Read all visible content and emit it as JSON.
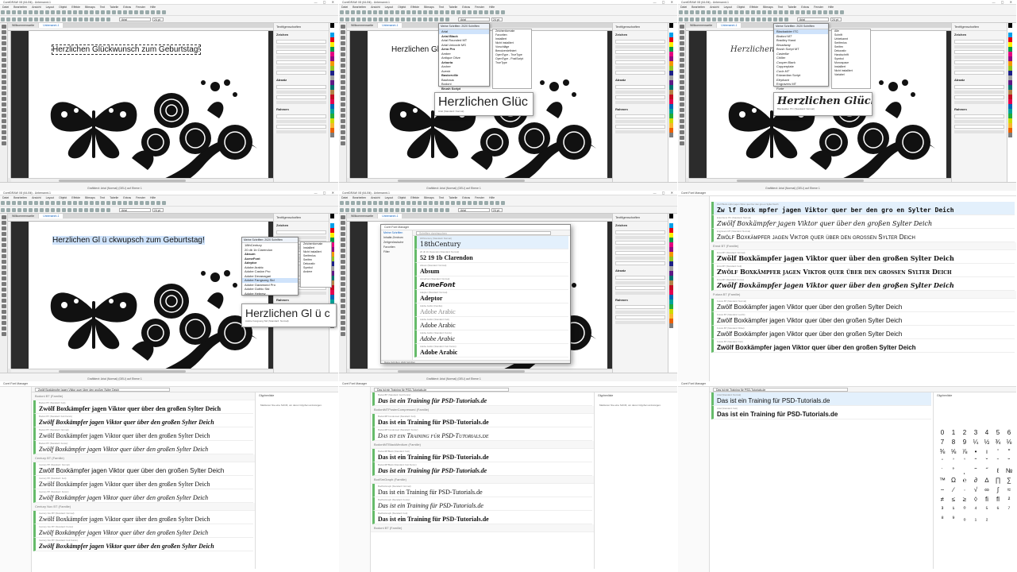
{
  "corel": {
    "title_a": "CorelDRAW X8 (64-Bit) - Unbenannt-1",
    "title_b": "CorelDRAW X8 (64-Bit) - Unbenannt-1",
    "menus": [
      "Datei",
      "Bearbeiten",
      "Ansicht",
      "Layout",
      "Objekt",
      "Effekte",
      "Bitmaps",
      "Text",
      "Tabelle",
      "Extras",
      "Fenster",
      "Hilfe"
    ],
    "tabs": [
      "Willkommensseite",
      "Unbenannt-1"
    ],
    "docker_title": "Textfigenschaften",
    "docker_sections": [
      "Zeichen",
      "Absatz",
      "Rahmen"
    ],
    "status_text": "Grafiktext: Arial (Normal) (DEU) auf Ebene 1",
    "font_value": "Arial",
    "size_value": "24 pt",
    "swatches": [
      "#000000",
      "#ffffff",
      "#00a0e9",
      "#e60012",
      "#fff100",
      "#009944",
      "#e4007f",
      "#920783",
      "#f39800",
      "#8fc31f",
      "#1d2088",
      "#a0a0a0",
      "#601986",
      "#00736d",
      "#b28247",
      "#c30d23",
      "#e5004f",
      "#0068b7",
      "#00a29a",
      "#22ac38",
      "#cfdb00",
      "#f8b62d",
      "#eb6100",
      "#7d7d7d"
    ]
  },
  "screens": [
    {
      "greeting": "Herzlichen Glückwunsch zum Geburtstag!"
    },
    {
      "greeting": "Herzlichen Glü",
      "list_header": "Meine Schriften: 2020 Schriften",
      "list_items": [
        "Arial",
        "Arial Black",
        "Arial Rounded MT",
        "Arial Unicode MS",
        "Arno Pro",
        "Amber",
        "Antique Olive",
        "Arboria",
        "Archer",
        "Avenir",
        "Baskerville",
        "Bauhaus",
        "Bodoni",
        "Brush Script"
      ],
      "filter_items": [
        "Zeichenformate",
        "Favoriten",
        "Installiert",
        "Nicht installiert",
        "Vorschläge",
        "Benutzerdefiniert",
        "OpenType - TrueType",
        "OpenType - PostScript",
        "TrueType"
      ],
      "preview_text": "Herzlichen Glüc",
      "preview_caption": "Arial (Standard: Normal)"
    },
    {
      "greeting": "Herzlichen Glückwu",
      "list_header": "Meine Schriften: 2020 Schriften",
      "list_items": [
        "Blackadder ITC",
        "Bodoni MT",
        "Bradley Hand",
        "Broadway",
        "Brush Script MT",
        "Castellar",
        "Chiller",
        "Cooper Black",
        "Copperplate",
        "Curlz MT",
        "Edwardian Script",
        "Elephant",
        "Engravers MT",
        "Forte"
      ],
      "filter_items": [
        "Alle",
        "Schrift",
        "Unbekannt",
        "Serifenlos",
        "Serifen",
        "Dekorativ",
        "Handschrift",
        "Symbol",
        "Monospace",
        "Installiert",
        "Nicht installiert",
        "Variabel"
      ],
      "preview_text": "Herzlichen Glückwu",
      "preview_caption": "Blackadder ITC (Standard: Normal)"
    },
    {
      "greeting": "Herzlichen Gl ü ckwupsch zum Geburtstag!",
      "list_header": "Meine Schriften: 2020 Schriften",
      "list_items": [
        "18thCentury",
        "20 db 1b Clarendon",
        "Absum",
        "AcmeFont",
        "Adeptor",
        "Adobe Arabic",
        "Adobe Caslon Pro",
        "Adobe Devanagari",
        "Adobe Fangsong Std",
        "Adobe Garamond Pro",
        "Adobe Gothic Std",
        "Adobe Hebrew"
      ],
      "filter_items": [
        "Zeichenformate",
        "Installiert",
        "Nicht installiert",
        "Serifenlos",
        "Serifen",
        "Dekorativ",
        "Symbol",
        "Andere"
      ],
      "preview_text": "Herzlichen Gl ü c",
      "preview_caption": "Adobe Fangsong Std (Standard: Normal)"
    },
    {
      "win_title": "Corel Font Manager",
      "search_placeholder": "Schriften durchsuchen",
      "entries": [
        {
          "meta": "18thCentury (Standard: Normal)",
          "sample": "18thCentury"
        },
        {
          "meta": "20 db 1b Clarendon (Standard: Normal)",
          "sample": "52 19 1b Clarendon"
        },
        {
          "meta": "Absum (Standard: Normal)",
          "sample": "Absum"
        },
        {
          "meta": "AcmeFont (Standard: Normal)",
          "sample": "AcmeFont"
        },
        {
          "meta": "Adeptor (Standard: Normal)",
          "sample": "Adeptor"
        },
        {
          "meta": "Adobe Arabic (Familie)",
          "sample": "Adobe Arabic"
        },
        {
          "meta": "Adobe Arabic (Standard: Fett)",
          "sample": "Adobe Arabic"
        },
        {
          "meta": "Adobe Arabic (Standard: Kursiv)",
          "sample": "Adobe Arabic"
        },
        {
          "meta": "Adobe Arabic (Standard: Fett Kursiv)",
          "sample": "Adobe Arabic"
        }
      ],
      "side": [
        "Meine Schriften",
        "Inhalte-Zentrum",
        "Zeitgenössische",
        "Favoriten",
        "Filter"
      ],
      "status": "Meine Schriften: 2020 Schriften"
    },
    {
      "title": "Corel Font Manager",
      "sample": "Zwölf Boxkämpfer jagen Viktor quer über den großen Sylter Deich",
      "families": [
        "Ernst BT (Familie)",
        "Futura BT (Familie)"
      ],
      "rows": [
        {
          "meta": "Zw lf Boxk mpfer jagen Viktor quer ber den gro en Sylter Deich",
          "sample": "Zw  lf Boxk  mpfer jagen Viktor quer   ber den gro  en Sylter Deich",
          "cls": "mono"
        },
        {
          "meta": "Eras Demi ITC (Standard: Normal)",
          "sample": "Zwölf Boxkämpfer jagen Viktor quer über den großen Sylter Deich",
          "cls": "script"
        },
        {
          "meta": "Engravers MT (Standard: Normal)",
          "sample": "Zwölf Boxkämpfer jagen Viktor quer über den grossen Sylter Deich",
          "cls": "caps"
        },
        {
          "meta": "Ernst BT (Standard: Normal)",
          "sample": "Zwölf Boxkämpfer jagen Viktor quer über den großen Sylter Deich",
          "cls": "bold"
        },
        {
          "meta": "Ernst BT (Standard: Fett)",
          "sample": "Zwölf Boxkämpfer jagen Viktor quer über den großen Sylter Deich",
          "cls": "boldcaps"
        },
        {
          "meta": "Ernst BT (Standard: Kursiv)",
          "sample": "Zwölf Boxkämpfer jagen Viktor quer über den großen Sylter Deich",
          "cls": "italic"
        },
        {
          "meta": "Futura BT (Standard: Normal)",
          "sample": "Zwölf Boxkämpfer jagen Viktor quer über den großen Sylter Deich",
          "cls": "sans"
        },
        {
          "meta": "Futura BT (Standard: Leicht)",
          "sample": "Zwölf Boxkämpfer jagen Viktor quer über den großen Sylter Deich",
          "cls": "sans"
        },
        {
          "meta": "Futura BT (Standard: Mittel)",
          "sample": "Zwölf Boxkämpfer jagen Viktor quer über den großen Sylter Deich",
          "cls": "sans"
        },
        {
          "meta": "Futura BT (Standard: Fett)",
          "sample": "Zwölf Boxkämpfer jagen Viktor quer über den großen Sylter Deich",
          "cls": "sansbold"
        }
      ]
    },
    {
      "title": "Corel Font Manager",
      "search_value": "Zwölf Boxkämpfer jagen Viktor quer über den großen Sylter Deich",
      "right_title": "Glyphenliste",
      "right_text": "Markieren Sie eine Schrift, um deren Glyphen anzuzeigen.",
      "rows": [
        {
          "meta": "Bodoni BT (Familie)",
          "sample": "",
          "fam": true
        },
        {
          "meta": "Bodoni BT (Standard: Fett)",
          "sample": "Zwölf Boxkämpfer jagen Viktor quer über den großen Sylter Deich",
          "cls": "serifbold"
        },
        {
          "meta": "Bodoni BT (Standard: Fett Kursiv)",
          "sample": "Zwölf Boxkämpfer jagen Viktor quer über den großen Sylter Deich",
          "cls": "serifbolditalic"
        },
        {
          "meta": "Bodoni BT (Standard: Normal)",
          "sample": "Zwölf Boxkämpfer jagen Viktor quer über den großen Sylter Deich",
          "cls": "serif"
        },
        {
          "meta": "Bodoni BT (Standard: Kursiv)",
          "sample": "Zwölf Boxkämpfer jagen Viktor quer über den großen Sylter Deich",
          "cls": "serifitalic"
        },
        {
          "meta": "Century BT (Familie)",
          "sample": "",
          "fam": true
        },
        {
          "meta": "Century BT (Standard: Normal)",
          "sample": "Zwölf Boxkämpfer jagen Viktor quer über den großen Sylter Deich",
          "cls": "sans"
        },
        {
          "meta": "Century BT (Standard: Fett)",
          "sample": "Zwölf Boxkämpfer jagen Viktor quer über den großen Sylter Deich",
          "cls": "serif"
        },
        {
          "meta": "Century BT (Standard: Kursiv)",
          "sample": "Zwölf Boxkämpfer jagen Viktor quer über den großen Sylter Deich",
          "cls": "serifitalic"
        },
        {
          "meta": "Century Nov BT (Familie)",
          "sample": "",
          "fam": true
        },
        {
          "meta": "Century Nov BT (Standard: Normal)",
          "sample": "Zwölf Boxkämpfer jagen Viktor quer über den großen Sylter Deich",
          "cls": "serif"
        },
        {
          "meta": "Century Nov BT (Standard: Kursiv)",
          "sample": "Zwölf Boxkämpfer jagen Viktor quer über den großen Sylter Deich",
          "cls": "serifitalic"
        },
        {
          "meta": "Century Nov BT (Standard: Fett Kursiv)",
          "sample": "Zwölf Boxkämpfer jagen Viktor quer über den großen Sylter Deich",
          "cls": "serifbolditalic"
        }
      ]
    },
    {
      "title": "Corel Font Manager",
      "search_value": "Das ist ein Training für PSD-Tutorials.de",
      "right_title": "Glyphenliste",
      "right_text": "Markieren Sie eine Schrift, um deren Glyphen anzuzeigen.",
      "rows": [
        {
          "meta": "BodoniBT (Standard: Fett Kursiv)",
          "sample": "Das ist ein Training für PSD-Tutorials.de",
          "cls": "serifbolditalic"
        },
        {
          "meta": "BodoniMTPosterCompressed (Familie)",
          "sample": "",
          "fam": true
        },
        {
          "meta": "BodoniMTCondensed (Standard: Fett)",
          "sample": "Das ist ein Training für PSD-Tutorials.de",
          "cls": "serifbold"
        },
        {
          "meta": "BodoniMTCondensed (Standard: Kursiv)",
          "sample": "Das ist ein Training für PSD-Tutorials.de",
          "cls": "smallcapsitalic"
        },
        {
          "meta": "BodoniMTBlackMedium (Familie)",
          "sample": "",
          "fam": true
        },
        {
          "meta": "BodoniMTBlack (Standard: Fett)",
          "sample": "Das ist ein Training für PSD-Tutorials.de",
          "cls": "serifbold"
        },
        {
          "meta": "BodoniMTBlack (Standard: Fett Kursiv)",
          "sample": "Das ist ein Training für PSD-Tutorials.de",
          "cls": "serifbolditalic"
        },
        {
          "meta": "BodSmGraph (Familie)",
          "sample": "",
          "fam": true
        },
        {
          "meta": "BodSmGraph (Standard: Normal)",
          "sample": "Das ist ein Training für PSD-Tutorials.de",
          "cls": "serif"
        },
        {
          "meta": "BodSmGraph (Standard: Kursiv)",
          "sample": "Das ist ein Training für PSD-Tutorials.de",
          "cls": "serifitalic"
        },
        {
          "meta": "BodSmGraph (Standard: Fett)",
          "sample": "Das ist ein Training für PSD-Tutorials.de",
          "cls": "serifbold"
        },
        {
          "meta": "Bodoni BT (Familie)",
          "sample": "",
          "fam": true
        }
      ]
    },
    {
      "title": "Corel Font Manager",
      "search_value": "Das ist ein Training für PSD-Tutorials.de",
      "right_title": "Glyphenliste",
      "rows": [
        {
          "meta": "Arial (Standard: Normal)",
          "sample": "Das ist ein Training für PSD-Tutorials.de",
          "cls": "sans"
        },
        {
          "meta": "Arial (Standard: Fett)",
          "sample": "Das ist ein Training für PSD-Tutorials.de",
          "cls": "sansbold"
        }
      ],
      "glyphs": [
        "0",
        "1",
        "2",
        "3",
        "4",
        "5",
        "6",
        "7",
        "8",
        "9",
        "¼",
        "½",
        "¾",
        "⅛",
        "⅜",
        "⅝",
        "⅞",
        "•",
        "ı",
        "ʹ",
        "ʺ",
        "ʻ",
        "ʼ",
        "ʽ",
        "ˆ",
        "ˇ",
        "ˉ",
        "˘",
        "˙",
        "˚",
        "˛",
        "˜",
        "˝",
        "ℓ",
        "№",
        "™",
        "Ω",
        "℮",
        "∂",
        "∆",
        "∏",
        "∑",
        "−",
        "∕",
        "∙",
        "√",
        "∞",
        "∫",
        "≈",
        "≠",
        "≤",
        "≥",
        "◊",
        "ﬁ",
        "ﬂ",
        "²",
        "³",
        "¹",
        "⁰",
        "⁴",
        "⁵",
        "⁶",
        "⁷",
        "⁸",
        "⁹",
        "₀",
        "₁",
        "₂"
      ]
    }
  ]
}
